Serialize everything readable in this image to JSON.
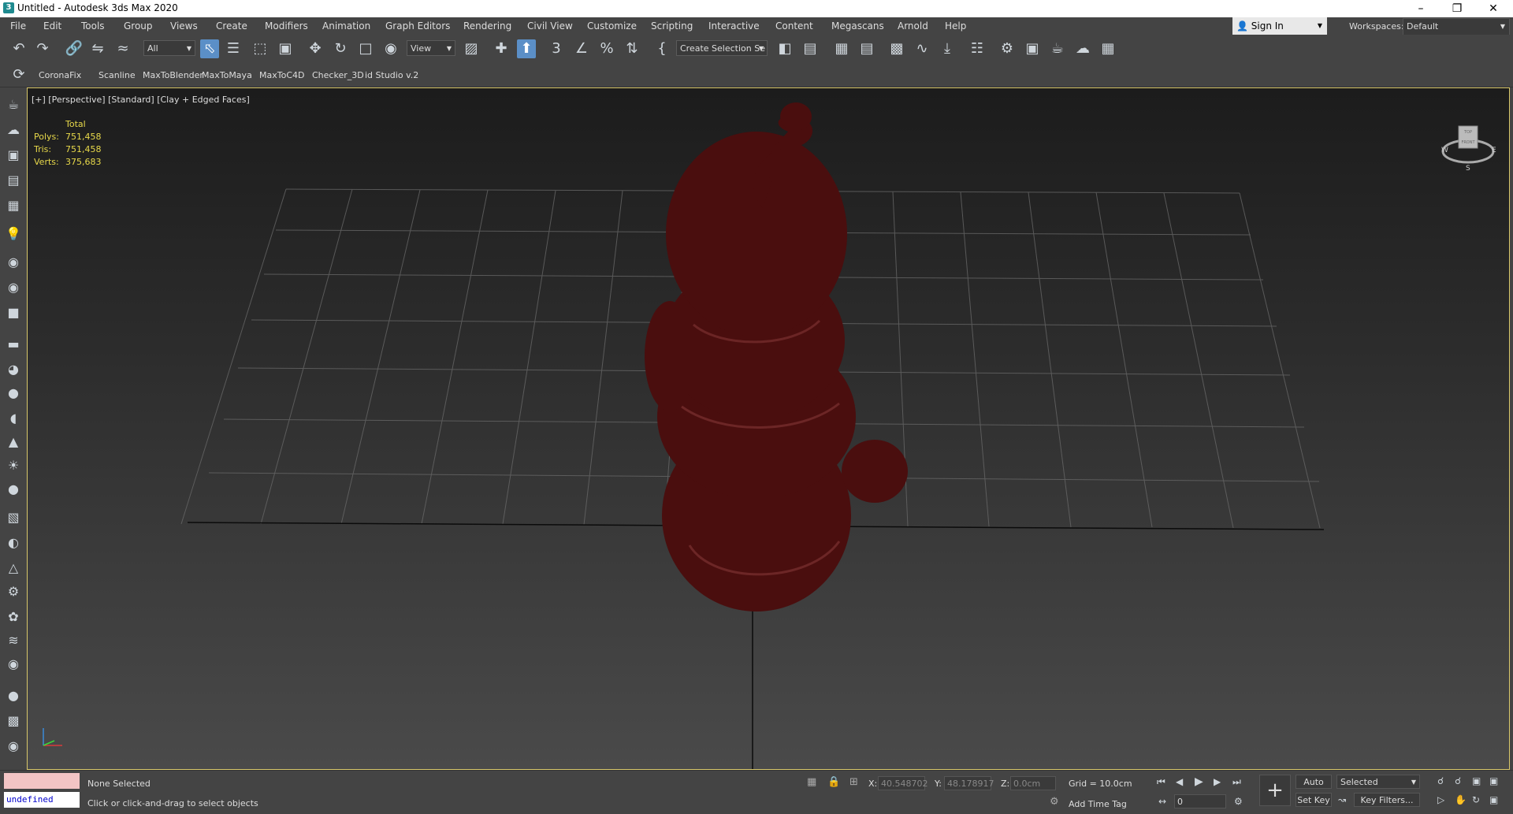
{
  "window": {
    "title": "Untitled - Autodesk 3ds Max 2020",
    "app_icon": "3",
    "controls": [
      "minimize-icon",
      "restore-icon",
      "close-icon"
    ]
  },
  "menubar": {
    "items": [
      "File",
      "Edit",
      "Tools",
      "Group",
      "Views",
      "Create",
      "Modifiers",
      "Animation",
      "Graph Editors",
      "Rendering",
      "Civil View",
      "Customize",
      "Scripting",
      "Interactive",
      "Content",
      "Megascans",
      "Arnold",
      "Help"
    ],
    "sign_in": "Sign In",
    "workspaces_label": "Workspaces:",
    "workspace_value": "Default"
  },
  "toolbar": {
    "filter_value": "All",
    "refcoord_value": "View",
    "selection_set_placeholder": "Create Selection Se"
  },
  "shelf": {
    "items": [
      "CoronaFix",
      "Scanline",
      "MaxToBlender",
      "MaxToMaya",
      "MaxToC4D",
      "Checker_3D",
      "id Studio v.2"
    ]
  },
  "viewport": {
    "label": "[+] [Perspective] [Standard] [Clay + Edged Faces]",
    "stats_header": "Total",
    "stats": [
      {
        "label": "Polys:",
        "value": "751,458"
      },
      {
        "label": "Tris:",
        "value": "751,458"
      },
      {
        "label": "Verts:",
        "value": "375,683"
      }
    ],
    "viewcube": {
      "top": "TOP",
      "front": "FRONT",
      "w": "W",
      "e": "E",
      "s": "S"
    },
    "object_color": "#4a0e0e",
    "frame_color": "#d8c76a"
  },
  "status": {
    "maxscript_output": "undefined",
    "selection": "None Selected",
    "prompt": "Click or click-and-drag to select objects",
    "x_label": "X:",
    "x_value": "40.548702",
    "y_label": "Y:",
    "y_value": "48.178917",
    "z_label": "Z:",
    "z_value": "0.0cm",
    "grid": "Grid = 10.0cm",
    "add_time_tag": "Add Time Tag",
    "auto_key": "Auto Key",
    "set_key": "Set Key",
    "key_mode_value": "Selected",
    "key_filters": "Key Filters...",
    "frame_value": "0"
  }
}
